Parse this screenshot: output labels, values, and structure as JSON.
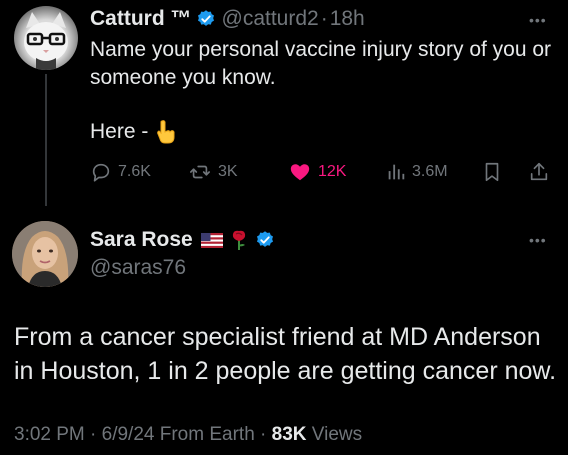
{
  "parent_tweet": {
    "author_name": "Catturd ™",
    "handle": "@catturd2",
    "separator": "·",
    "time": "18h",
    "text": "Name your personal vaccine injury story of you or someone you know.",
    "here_text": "Here -",
    "emoji": "pointing-down-hand",
    "more_label": "•••",
    "metrics": {
      "replies": "7.6K",
      "reposts": "3K",
      "likes": "12K",
      "views": "3.6M"
    }
  },
  "reply_tweet": {
    "author_name": "Sara Rose",
    "name_emojis": [
      "us-flag",
      "rose"
    ],
    "handle": "@saras76",
    "more_label": "•••",
    "text": "From a cancer specialist friend at MD Anderson in Houston, 1 in 2 people are getting cancer now.",
    "timestamp": "3:02 PM · 6/9/24 From Earth ·",
    "views_count": "83K",
    "views_label": "Views"
  },
  "colors": {
    "background": "#000000",
    "primary_text": "#e7e9ea",
    "secondary_text": "#71767b",
    "verified_blue": "#1d9bf0",
    "like_pink": "#f91880"
  }
}
